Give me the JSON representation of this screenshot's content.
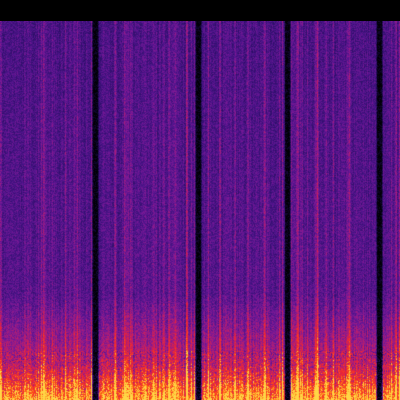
{
  "image": {
    "kind": "spectrogram",
    "colormap": "magma-like",
    "palette": [
      "#000004",
      "#2a0a5e",
      "#4a1a8a",
      "#8b1f9a",
      "#c8286a",
      "#f02a2a",
      "#ff7a1a",
      "#ffd040"
    ],
    "top_band_color": "#000000",
    "background_color": "#000000",
    "gap_count": 4
  }
}
